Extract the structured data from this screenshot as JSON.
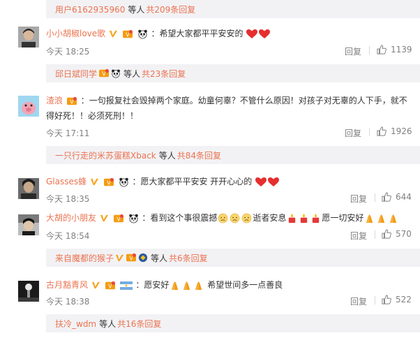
{
  "threads": [
    {
      "sub": {
        "user": "用户6162935960",
        "and": "等人",
        "count": "共209条回复"
      }
    },
    {
      "user": "小小胡椒love歌",
      "text": "希望大家都平平安安的",
      "time": "今天 18:25",
      "reply": "回复",
      "likes": "1139",
      "sub": {
        "user": "邱日斌同学",
        "and": "等人",
        "count": "共23条回复"
      }
    },
    {
      "user": "渣浪",
      "text": "一句报复社会毁掉两个家庭。幼童何辜？不管什么原因！对孩子对无辜的人下手，就不得好死！！必须死刑！！",
      "time": "今天 17:11",
      "reply": "回复",
      "likes": "1926",
      "sub": {
        "user": "一只行走的米苏蛋糕Xback",
        "and": "等人",
        "count": "共84条回复"
      }
    },
    {
      "user": "Glasses蜂",
      "text": "愿大家都平平安安 开开心心的",
      "time": "今天 18:35",
      "reply": "回复",
      "likes": "644"
    },
    {
      "user": "大胡的小朋友",
      "text_a": "看到这个事很震撼",
      "text_b": "逝者安息",
      "text_c": "愿一切安好",
      "time": "今天 18:54",
      "reply": "回复",
      "likes": "570",
      "sub": {
        "user": "来自魔都的猴子",
        "and": "等人",
        "count": "共6条回复"
      }
    },
    {
      "user": "古月豁青风",
      "text_a": "愿安好",
      "text_b": "希望世间多一点善良",
      "time": "今天 18:38",
      "reply": "回复",
      "likes": "522",
      "sub": {
        "user": "扶冷_wdm",
        "and": "等人",
        "count": "共16条回复"
      }
    }
  ],
  "colors": {
    "accent": "#eb7350",
    "muted": "#808080",
    "subbg": "#f2f2f5"
  },
  "icons": [
    "verified-v-icon",
    "member-badge-icon",
    "panda-icon",
    "heart-icon",
    "pray-icon",
    "candle-icon",
    "sad-face-icon",
    "thumbs-up-icon",
    "flag-icon",
    "circle-badge-icon"
  ]
}
